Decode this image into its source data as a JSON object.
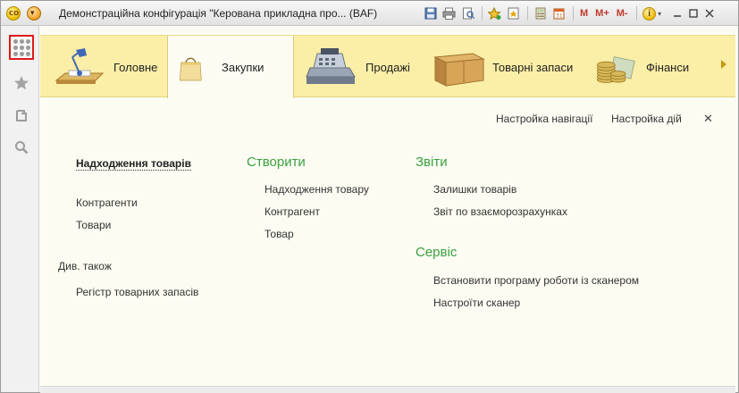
{
  "window": {
    "title": "Демонстраційна конфігурація \"Керована прикладна про... (BAF)"
  },
  "toolbar": {
    "m": "M",
    "m_plus": "M+",
    "m_minus": "M-",
    "info": "i"
  },
  "sections": [
    {
      "label": "Головне",
      "icon": "desk-lamp-icon"
    },
    {
      "label": "Закупки",
      "icon": "shopping-bag-icon"
    },
    {
      "label": "Продажі",
      "icon": "cash-register-icon"
    },
    {
      "label": "Товарні запаси",
      "icon": "cardboard-box-icon"
    },
    {
      "label": "Фінанси",
      "icon": "coins-icon"
    }
  ],
  "panel_links": {
    "nav_settings": "Настройка навігації",
    "action_settings": "Настройка дій"
  },
  "columns": {
    "main": {
      "primary": "Надходження товарів",
      "items": [
        "Контрагенти",
        "Товари"
      ],
      "see_also": "Див. також",
      "see_also_items": [
        "Регістр товарних запасів"
      ]
    },
    "create": {
      "title": "Створити",
      "items": [
        "Надходження товару",
        "Контрагент",
        "Товар"
      ]
    },
    "reports": {
      "title": "Звіти",
      "items": [
        "Залишки товарів",
        "Звіт по взаєморозрахунках"
      ]
    },
    "service": {
      "title": "Сервіс",
      "items": [
        "Встановити програму роботи із сканером",
        "Настроїти сканер"
      ]
    }
  },
  "colors": {
    "accent_green": "#3aa040",
    "section_bg": "#fbeea6",
    "active_rail_border": "#e01a1a"
  }
}
